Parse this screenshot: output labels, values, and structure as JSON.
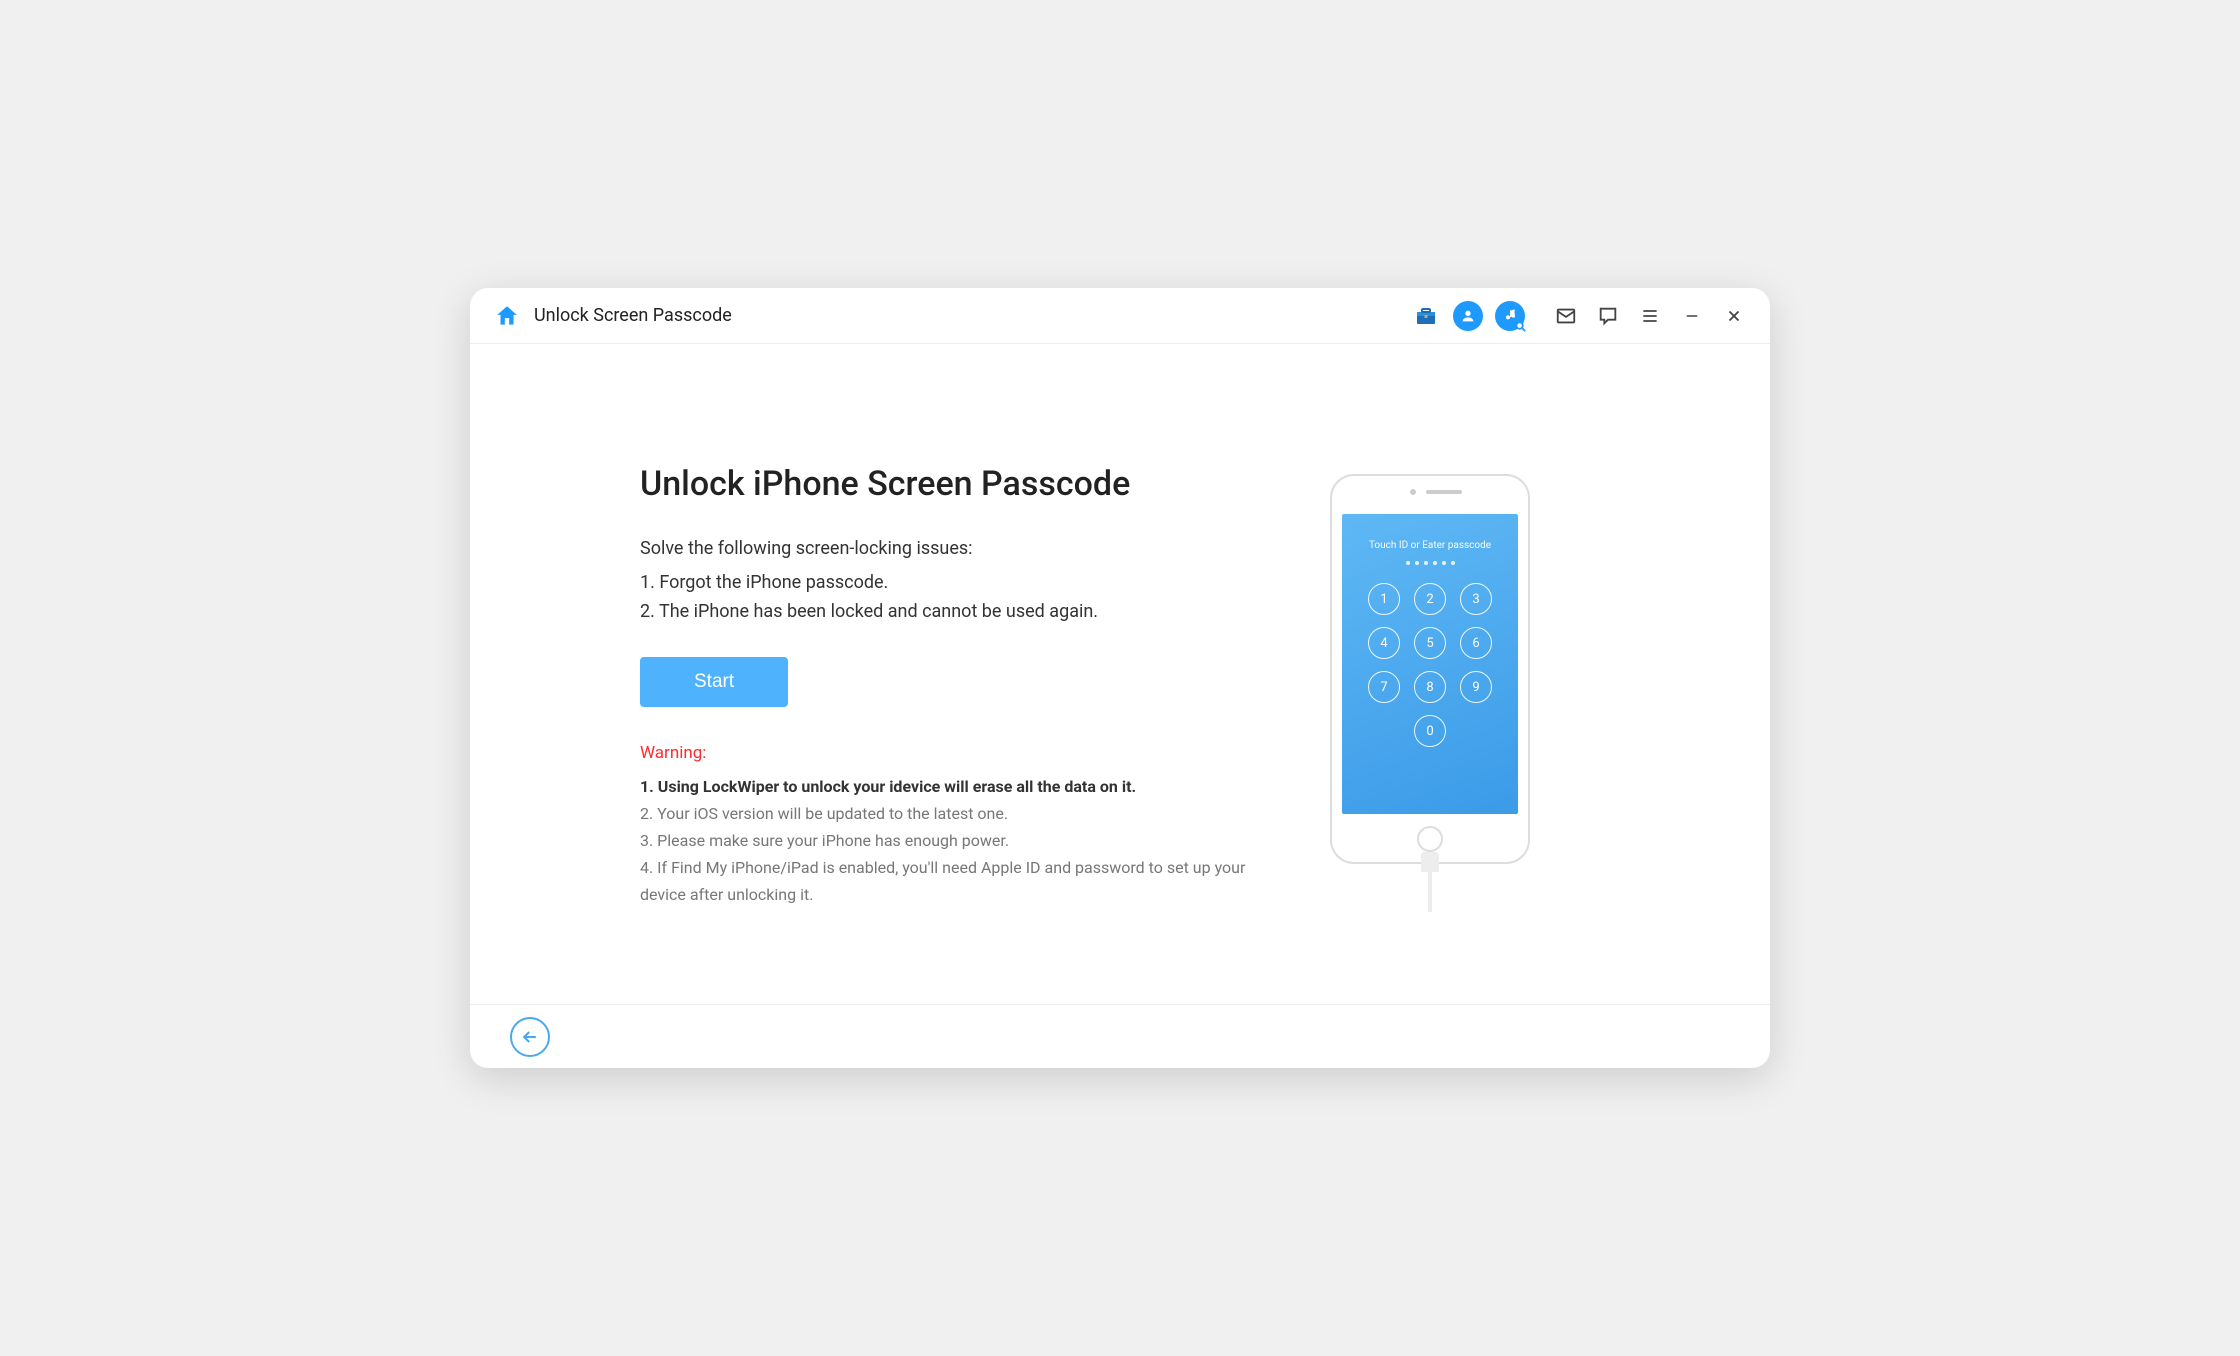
{
  "titlebar": {
    "title": "Unlock Screen Passcode"
  },
  "main": {
    "heading": "Unlock iPhone Screen Passcode",
    "subheading": "Solve the following screen-locking issues:",
    "issues": [
      "1. Forgot the iPhone passcode.",
      "2. The iPhone has been locked and cannot be used again."
    ],
    "start_label": "Start",
    "warning_label": "Warning:",
    "warnings": [
      "1. Using LockWiper to unlock your idevice will erase all the data on it.",
      "2. Your iOS version will be updated to the latest one.",
      "3. Please make sure your iPhone has enough power.",
      "4. If Find My iPhone/iPad is enabled, you'll need Apple ID and password to set up your device after unlocking it."
    ]
  },
  "phone": {
    "screen_text": "Touch ID or Eater passcode",
    "keys": [
      "1",
      "2",
      "3",
      "4",
      "5",
      "6",
      "7",
      "8",
      "9",
      "0"
    ]
  }
}
